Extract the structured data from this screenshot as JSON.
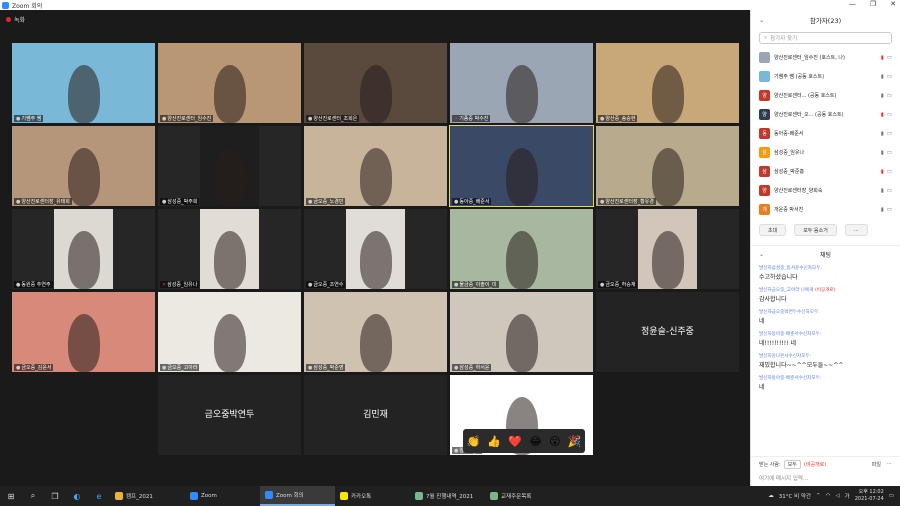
{
  "window": {
    "title": "Zoom 회의",
    "controls": [
      "—",
      "❐",
      "✕"
    ]
  },
  "recording": {
    "label": "녹화"
  },
  "tiles": [
    {
      "label": "기쌤주 쌤",
      "bg": "#7ab8d8",
      "muted": false
    },
    {
      "label": "양산진로센터_임수진",
      "bg": "#b89874",
      "muted": false
    },
    {
      "label": "양산진로센터_조희은",
      "bg": "#5a4a3e",
      "muted": false
    },
    {
      "label": "기종중 박수진",
      "bg": "#9aa6b4",
      "muted": true
    },
    {
      "label": "양산중_송승현",
      "bg": "#c8a878",
      "muted": false
    },
    {
      "label": "양산진로센터장_유태희",
      "bg": "#b6967a",
      "muted": false
    },
    {
      "label": "삼성중_박주희",
      "bg": "#1e1e1e",
      "muted": false
    },
    {
      "label": "금오중_노경민",
      "bg": "#c8b49a",
      "muted": false
    },
    {
      "label": "동아중_배준서",
      "bg": "#3a4a66",
      "muted": false
    },
    {
      "label": "양산진로센터장_황유경",
      "bg": "#b8aa8c",
      "muted": false
    },
    {
      "label": "동원중 추연주",
      "bg": "#dcd8d2",
      "muted": false
    },
    {
      "label": "삼성중_임유나",
      "bg": "#e2dcd6",
      "muted": true
    },
    {
      "label": "금오중_조연수",
      "bg": "#e0ddd8",
      "muted": false
    },
    {
      "label": "물금중_이솔이_미",
      "bg": "#a8b8a0",
      "muted": false
    },
    {
      "label": "금오중_허승재",
      "bg": "#d2c6ba",
      "muted": false
    },
    {
      "label": "금오중_김윤서",
      "bg": "#d88a7a",
      "muted": false
    },
    {
      "label": "금오중_고아라",
      "bg": "#ece8e2",
      "muted": false
    },
    {
      "label": "삼성중_박준영",
      "bg": "#cfc2b0",
      "muted": false
    },
    {
      "label": "삼성중_하서윤",
      "bg": "#cfc6bc",
      "muted": false
    },
    {
      "label": "",
      "bg": "#1a1a1a",
      "muted": false,
      "name": "정윤슬-신주중"
    },
    {
      "label": "",
      "bg": "#1a1a1a",
      "muted": false,
      "empty": true
    },
    {
      "label": "",
      "bg": "#1a1a1a",
      "muted": false,
      "name": "금오중박연두"
    },
    {
      "label": "",
      "bg": "#1a1a1a",
      "muted": false,
      "name": "김민재"
    },
    {
      "label": "양산중_황",
      "bg": "#ffffff",
      "muted": false
    },
    {
      "label": "",
      "bg": "#1a1a1a",
      "muted": false,
      "empty": true
    }
  ],
  "reactions": [
    "👏",
    "👍",
    "❤️",
    "😂",
    "😮",
    "🎉"
  ],
  "participants": {
    "title": "참가자(23)",
    "search_placeholder": "참가자 찾기",
    "list": [
      {
        "initial": "",
        "name": "양산진로센터_임수진 (호스트, 나)",
        "color": "#9aa6b4"
      },
      {
        "initial": "",
        "name": "기쌤주 쌤 (공동 호스트)",
        "color": "#7ab8d8"
      },
      {
        "initial": "양",
        "name": "양산진로센터... (공동 호스트)",
        "color": "#c0392b"
      },
      {
        "initial": "양",
        "name": "양산진로센터_오... (공동 호스트)",
        "color": "#2c3e50"
      },
      {
        "initial": "동",
        "name": "동아중-배준서",
        "color": "#c0392b"
      },
      {
        "initial": "삼",
        "name": "삼성중_임유나",
        "color": "#f39c12"
      },
      {
        "initial": "삼",
        "name": "삼성중_박준홍",
        "color": "#c0392b"
      },
      {
        "initial": "양",
        "name": "양산진로센터장_양희숙",
        "color": "#c0392b"
      },
      {
        "initial": "개",
        "name": "개운중 박서진",
        "color": "#e67e22"
      }
    ],
    "invite": "초대",
    "mute_all": "모두 음소거",
    "more": "..."
  },
  "chat": {
    "title": "채팅",
    "messages": [
      {
        "from": "발신자삼성중_동서윤수신자모두:",
        "private": "",
        "text": "수고하셨습니다"
      },
      {
        "from": "발신자금오중_고아라 나에게",
        "private": "(비공개로)",
        "text": "감사합니다"
      },
      {
        "from": "발신자금오중박연두수신자모두:",
        "private": "",
        "text": "네"
      },
      {
        "from": "발신자동아중-배준서수신자모두:",
        "private": "",
        "text": "네!!!!!!!!!! 네"
      },
      {
        "from": "발신자윤나은사수신자모두:",
        "private": "",
        "text": "재밌합니다~~^^모두들~~^^"
      },
      {
        "from": "발신자동아중-배준서수신자모두:",
        "private": "",
        "text": "네"
      }
    ],
    "to_label": "받는 사람:",
    "to_value": "모두",
    "to_private": "(비공개로)",
    "file_label": "파일",
    "input_placeholder": "여기에 메시지 입력..."
  },
  "taskbar": {
    "apps": [
      {
        "label": "캠프_2021",
        "color": "#e8b43c",
        "active": false
      },
      {
        "label": "Zoom",
        "color": "#2d8cff",
        "active": false
      },
      {
        "label": "Zoom 회의",
        "color": "#2d8cff",
        "active": true
      },
      {
        "label": "카카오톡",
        "color": "#f7e600",
        "active": false
      },
      {
        "label": "7월 진행내역_2021",
        "color": "#7ab88a",
        "active": false
      },
      {
        "label": "교재주문목록",
        "color": "#7ab88a",
        "active": false
      }
    ],
    "weather": "31°C 비 약간",
    "lang": "가",
    "time": "오후 12:02",
    "date": "2021-07-24"
  }
}
